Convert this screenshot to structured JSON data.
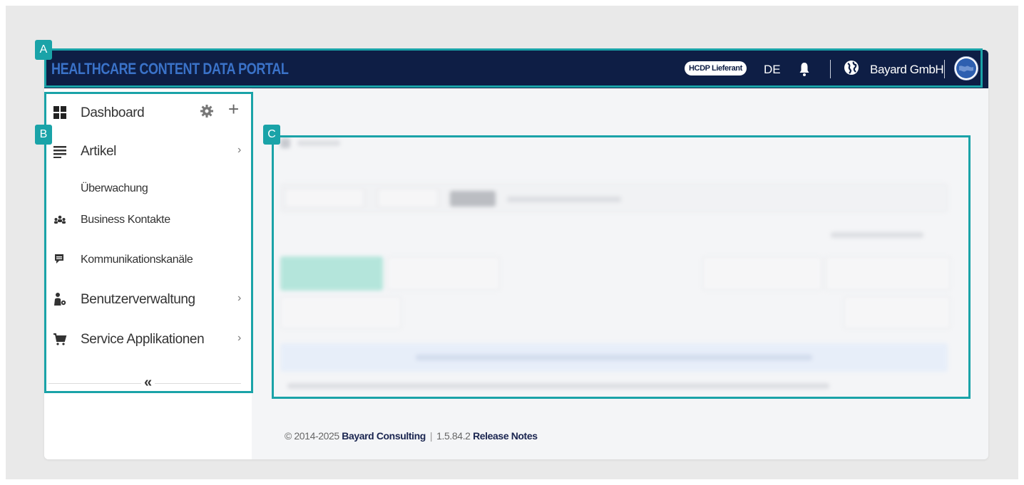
{
  "header": {
    "title": "HEALTHCARE CONTENT DATA PORTAL",
    "role_badge": "HCDP Lieferant",
    "language": "DE",
    "bell_icon": "bell-icon",
    "globe_icon": "globe-icon",
    "company": "Bayard GmbH",
    "avatar_icon": "user-avatar"
  },
  "sidebar": {
    "dashboard_label": "Dashboard",
    "items": [
      {
        "label": "Artikel",
        "icon": "list-icon",
        "has_chevron": true
      },
      {
        "label": "Überwachung",
        "icon": "",
        "has_chevron": false
      },
      {
        "label": "Business Kontakte",
        "icon": "contacts-icon",
        "has_chevron": false
      },
      {
        "label": "Kommunikationskanäle",
        "icon": "chat-icon",
        "has_chevron": false
      },
      {
        "label": "Benutzerverwaltung",
        "icon": "user-settings-icon",
        "has_chevron": true
      },
      {
        "label": "Service Applikationen",
        "icon": "cart-icon",
        "has_chevron": true
      }
    ],
    "chevron": "›",
    "collapse_glyph": "«"
  },
  "footer": {
    "copyright": "© 2014-2025",
    "company": "Bayard Consulting",
    "version": "1.5.84.2",
    "release_notes": "Release Notes"
  },
  "annotations": {
    "a": "A",
    "b": "B",
    "c": "C"
  },
  "colors": {
    "header_bg": "#0e1e45",
    "title_blue": "#3a72c8",
    "annotation": "#1aa3a8"
  }
}
